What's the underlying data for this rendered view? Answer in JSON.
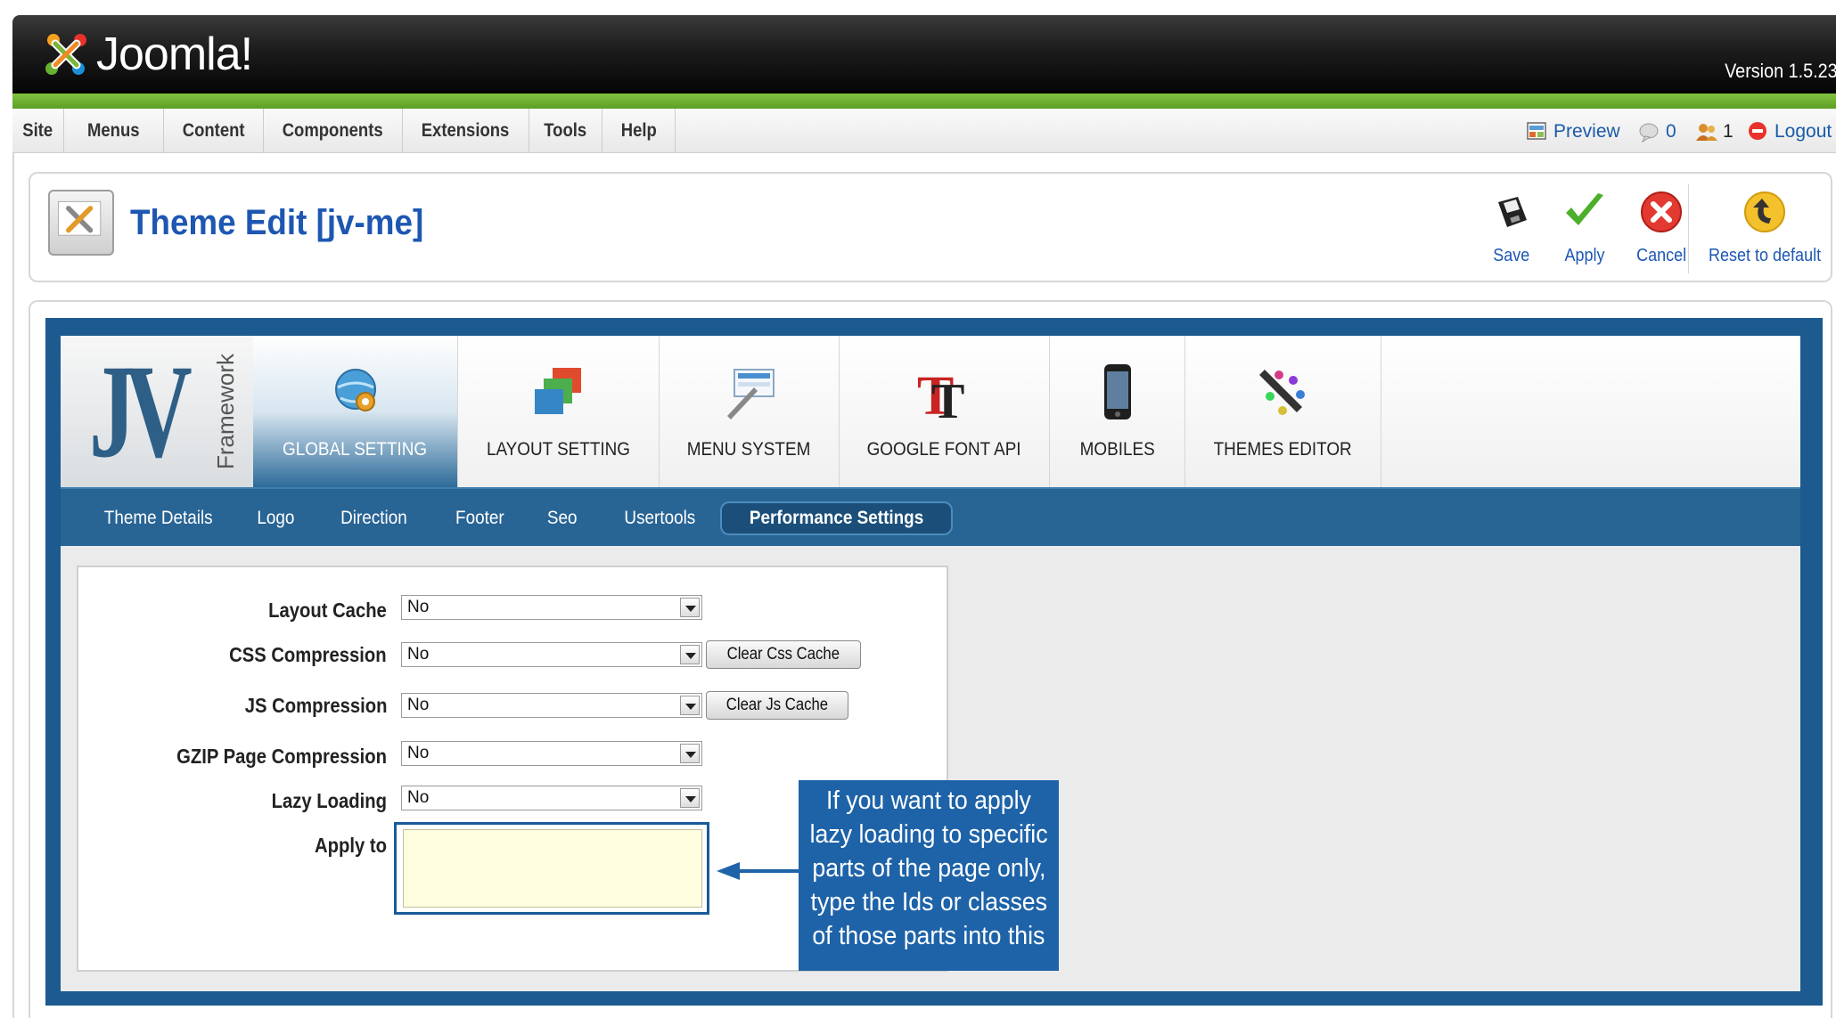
{
  "header": {
    "logo_text": "Joomla!",
    "version": "Version 1.5.23"
  },
  "menubar": {
    "items": [
      {
        "label": "Site"
      },
      {
        "label": "Menus"
      },
      {
        "label": "Content"
      },
      {
        "label": "Components"
      },
      {
        "label": "Extensions"
      },
      {
        "label": "Tools"
      },
      {
        "label": "Help"
      }
    ],
    "status": {
      "preview": "Preview",
      "messages_count": "0",
      "users_count": "1",
      "logout": "Logout"
    }
  },
  "title_bar": {
    "title": "Theme Edit [jv-me]",
    "toolbar": {
      "save": "Save",
      "apply": "Apply",
      "cancel": "Cancel",
      "reset": "Reset to default"
    }
  },
  "framework": {
    "logo_letters": "JV",
    "logo_word": "Framework",
    "tabs": [
      {
        "label": "GLOBAL SETTING",
        "icon": "globe-gear-icon",
        "active": true
      },
      {
        "label": "LAYOUT SETTING",
        "icon": "layers-icon"
      },
      {
        "label": "MENU SYSTEM",
        "icon": "menu-pen-icon"
      },
      {
        "label": "GOOGLE FONT API",
        "icon": "font-icon"
      },
      {
        "label": "MOBILES",
        "icon": "phone-icon"
      },
      {
        "label": "THEMES EDITOR",
        "icon": "palette-pencil-icon"
      }
    ],
    "subtabs": [
      {
        "label": "Theme Details"
      },
      {
        "label": "Logo"
      },
      {
        "label": "Direction"
      },
      {
        "label": "Footer"
      },
      {
        "label": "Seo"
      },
      {
        "label": "Usertools"
      },
      {
        "label": "Performance Settings",
        "active": true
      }
    ]
  },
  "form": {
    "layout_cache": {
      "label": "Layout Cache",
      "value": "No"
    },
    "css_compression": {
      "label": "CSS Compression",
      "value": "No",
      "button": "Clear Css Cache"
    },
    "js_compression": {
      "label": "JS Compression",
      "value": "No",
      "button": "Clear Js Cache"
    },
    "gzip": {
      "label": "GZIP Page Compression",
      "value": "No"
    },
    "lazy_loading": {
      "label": "Lazy Loading",
      "value": "No"
    },
    "apply_to": {
      "label": "Apply to",
      "value": ""
    }
  },
  "callout": {
    "lines": [
      "If you want to apply",
      "lazy loading to specific",
      "parts of the page only,",
      "type the Ids or classes",
      "of those parts into this"
    ]
  },
  "colors": {
    "accent_blue": "#1d57b2",
    "frame_blue": "#1c5a8f",
    "callout_blue": "#1e63a8",
    "joomla_green": "#82c341"
  }
}
